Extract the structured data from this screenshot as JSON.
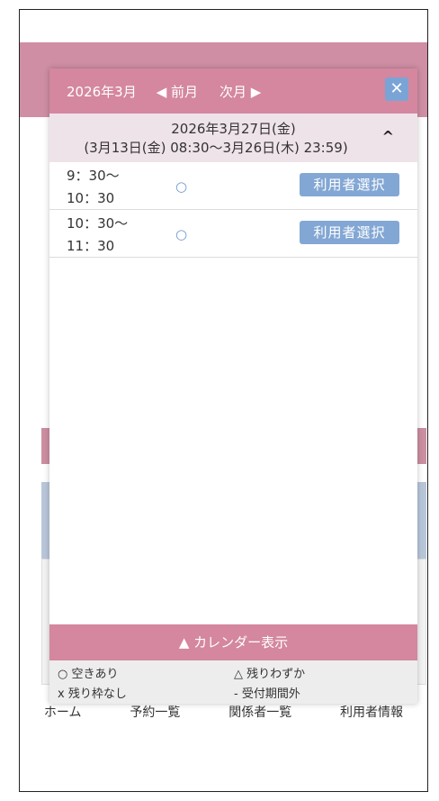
{
  "background": {
    "header_icon": "person-icon",
    "footer_tabs": [
      "ホーム",
      "予約一覧",
      "関係者一覧",
      "利用者情報"
    ]
  },
  "modal": {
    "month": "2026年3月",
    "prev": "◀ 前月",
    "next": "次月 ▶",
    "close": "✕",
    "date_line": "2026年3月27日(金)",
    "period_line": "(3月13日(金) 08:30〜3月26日(木) 23:59)",
    "collapse": "^",
    "slots": [
      {
        "start": "9：30〜",
        "end": "10：30",
        "status": "○",
        "button": "利用者選択"
      },
      {
        "start": "10：30〜",
        "end": "11：30",
        "status": "○",
        "button": "利用者選択"
      }
    ],
    "calendar_toggle": "▲ カレンダー表示",
    "legend": {
      "available": "○ 空きあり",
      "few": "△ 残りわずか",
      "full": "x 残り枠なし",
      "outside": "- 受付期間外"
    }
  },
  "colors": {
    "accent": "#d4879f",
    "button": "#83a7d4",
    "date_band": "#efe3ea"
  }
}
